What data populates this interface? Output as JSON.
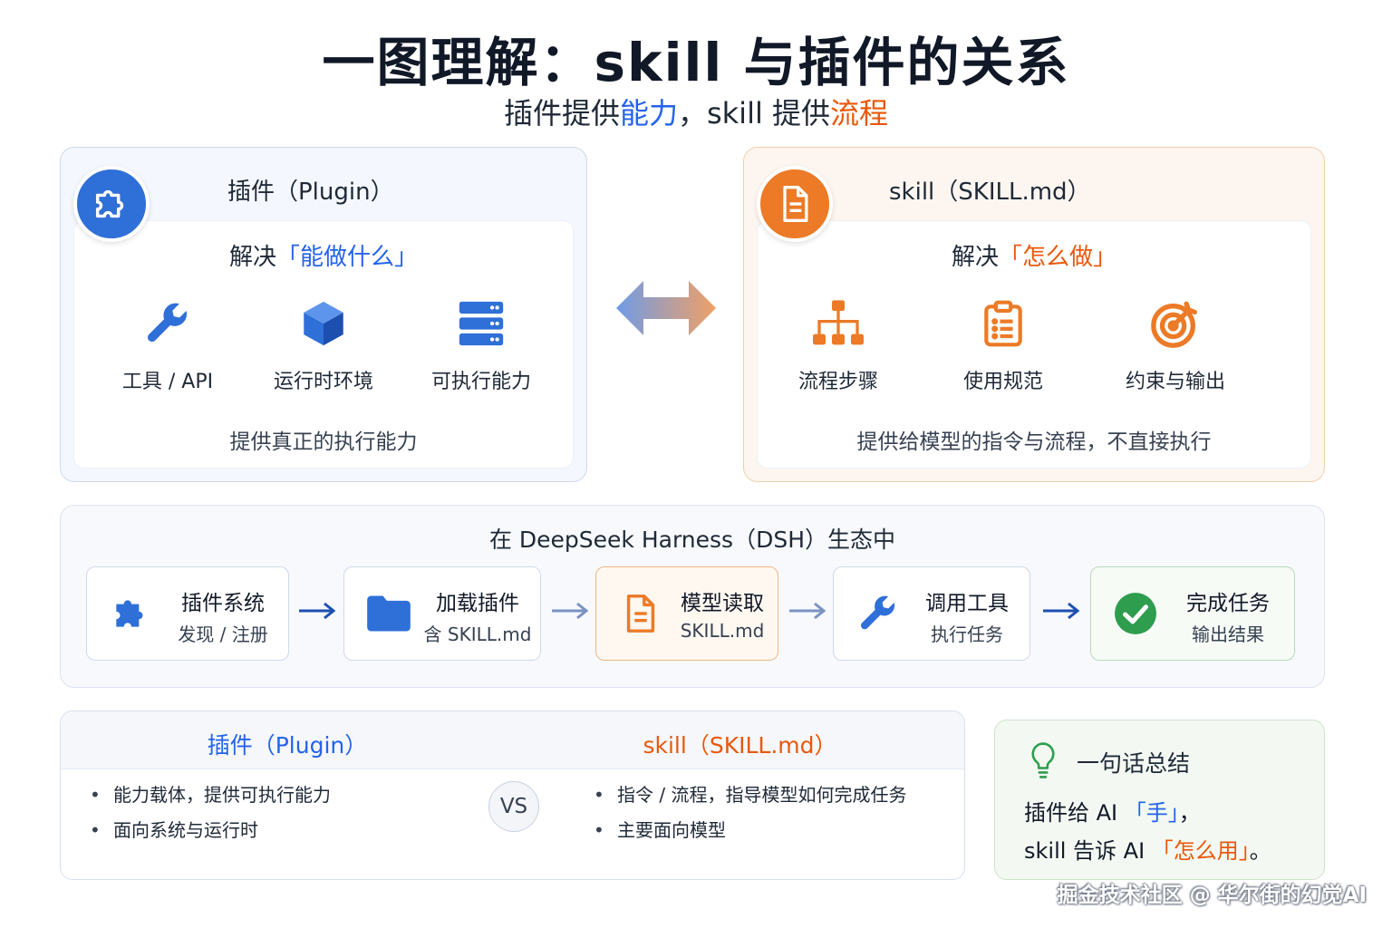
{
  "header": {
    "title": "一图理解：skill 与插件的关系",
    "subtitle_a": "插件提供",
    "subtitle_b": "能力",
    "subtitle_c": "，skill 提供",
    "subtitle_d": "流程"
  },
  "plugin_panel": {
    "title": "插件（Plugin）",
    "solves_prefix": "解决",
    "solves_highlight": "「能做什么」",
    "features": [
      {
        "label": "工具 / API",
        "icon": "wrench-icon"
      },
      {
        "label": "运行时环境",
        "icon": "cube-icon"
      },
      {
        "label": "可执行能力",
        "icon": "server-icon"
      }
    ],
    "footer": "提供真正的执行能力",
    "color": "#2f6fd8"
  },
  "skill_panel": {
    "title": "skill（SKILL.md）",
    "solves_prefix": "解决",
    "solves_highlight": "「怎么做」",
    "features": [
      {
        "label": "流程步骤",
        "icon": "org-chart-icon"
      },
      {
        "label": "使用规范",
        "icon": "clipboard-icon"
      },
      {
        "label": "约束与输出",
        "icon": "target-icon"
      }
    ],
    "footer": "提供给模型的指令与流程，不直接执行",
    "color": "#ec7a26"
  },
  "ecosystem": {
    "title": "在 DeepSeek Harness（DSH）生态中",
    "steps": [
      {
        "title": "插件系统",
        "subtitle": "发现 / 注册",
        "icon": "puzzle-icon"
      },
      {
        "title": "加载插件",
        "subtitle": "含 SKILL.md",
        "icon": "folder-icon"
      },
      {
        "title": "模型读取",
        "subtitle": "SKILL.md",
        "icon": "document-icon"
      },
      {
        "title": "调用工具",
        "subtitle": "执行任务",
        "icon": "wrench-icon"
      },
      {
        "title": "完成任务",
        "subtitle": "输出结果",
        "icon": "check-circle-icon"
      }
    ]
  },
  "comparison": {
    "left_title": "插件（Plugin）",
    "right_title": "skill（SKILL.md）",
    "vs": "VS",
    "left_items": [
      "能力载体，提供可执行能力",
      "面向系统与运行时"
    ],
    "right_items": [
      "指令 / 流程，指导模型如何完成任务",
      "主要面向模型"
    ]
  },
  "summary": {
    "title": "一句话总结",
    "line1_a": "插件给 AI ",
    "line1_b": "「手」",
    "line1_c": "，",
    "line2_a": "skill 告诉 AI ",
    "line2_b": "「怎么用」",
    "line2_c": "。"
  },
  "watermark": "掘金技术社区 @ 华尔街的幻觉AI"
}
